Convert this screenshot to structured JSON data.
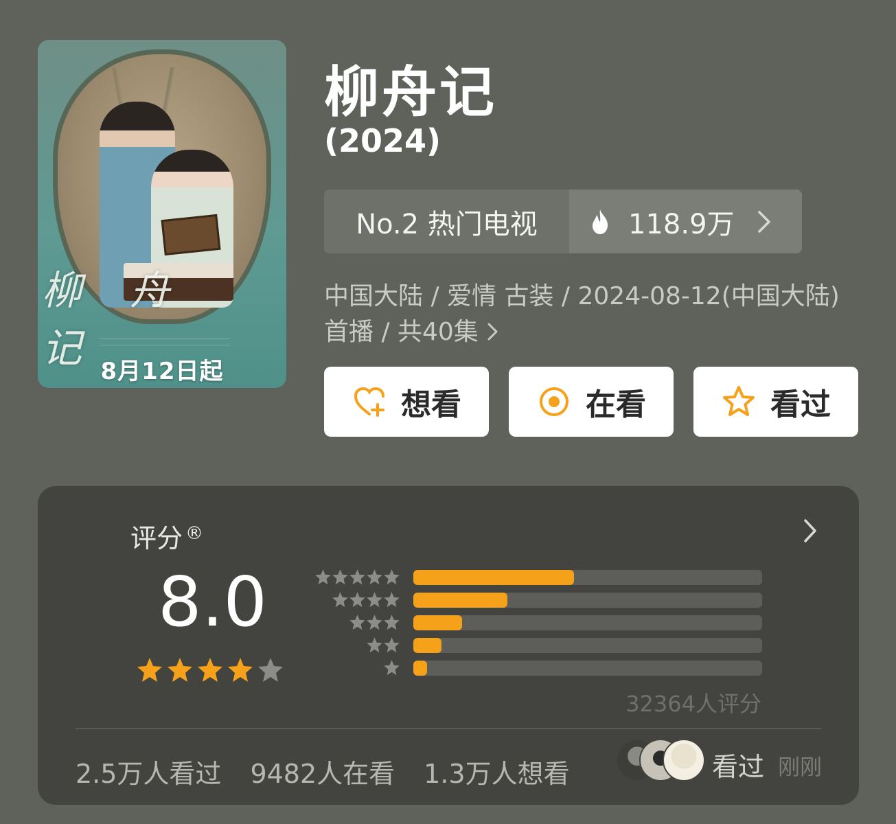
{
  "poster": {
    "calligraphy": "柳舟记",
    "date_text": "8月12日起"
  },
  "title": "柳舟记",
  "year": "(2024)",
  "rank": {
    "label": "No.2 热门电视",
    "heat": "118.9万"
  },
  "meta": {
    "line": "中国大陆 / 爱情 古装 / 2024-08-12(中国大陆)首播 / 共40集"
  },
  "actions": [
    {
      "label": "想看",
      "icon": "heart-plus-icon"
    },
    {
      "label": "在看",
      "icon": "target-dot-icon"
    },
    {
      "label": "看过",
      "icon": "star-outline-icon"
    }
  ],
  "rating": {
    "label": "评分",
    "reg_mark": "®",
    "score": "8.0",
    "stars_filled": 4,
    "stars_total": 5,
    "distribution": [
      {
        "stars": 5,
        "fraction": 0.46
      },
      {
        "stars": 4,
        "fraction": 0.27
      },
      {
        "stars": 3,
        "fraction": 0.14
      },
      {
        "stars": 2,
        "fraction": 0.08
      },
      {
        "stars": 1,
        "fraction": 0.04
      }
    ],
    "count_text": "32364人评分",
    "stats": [
      "2.5万人看过",
      "9482人在看",
      "1.3万人想看"
    ],
    "recent_label": "看过",
    "recent_time": "刚刚"
  },
  "colors": {
    "accent": "#f6a11a",
    "background": "#5e625b",
    "card": "#43443f"
  }
}
